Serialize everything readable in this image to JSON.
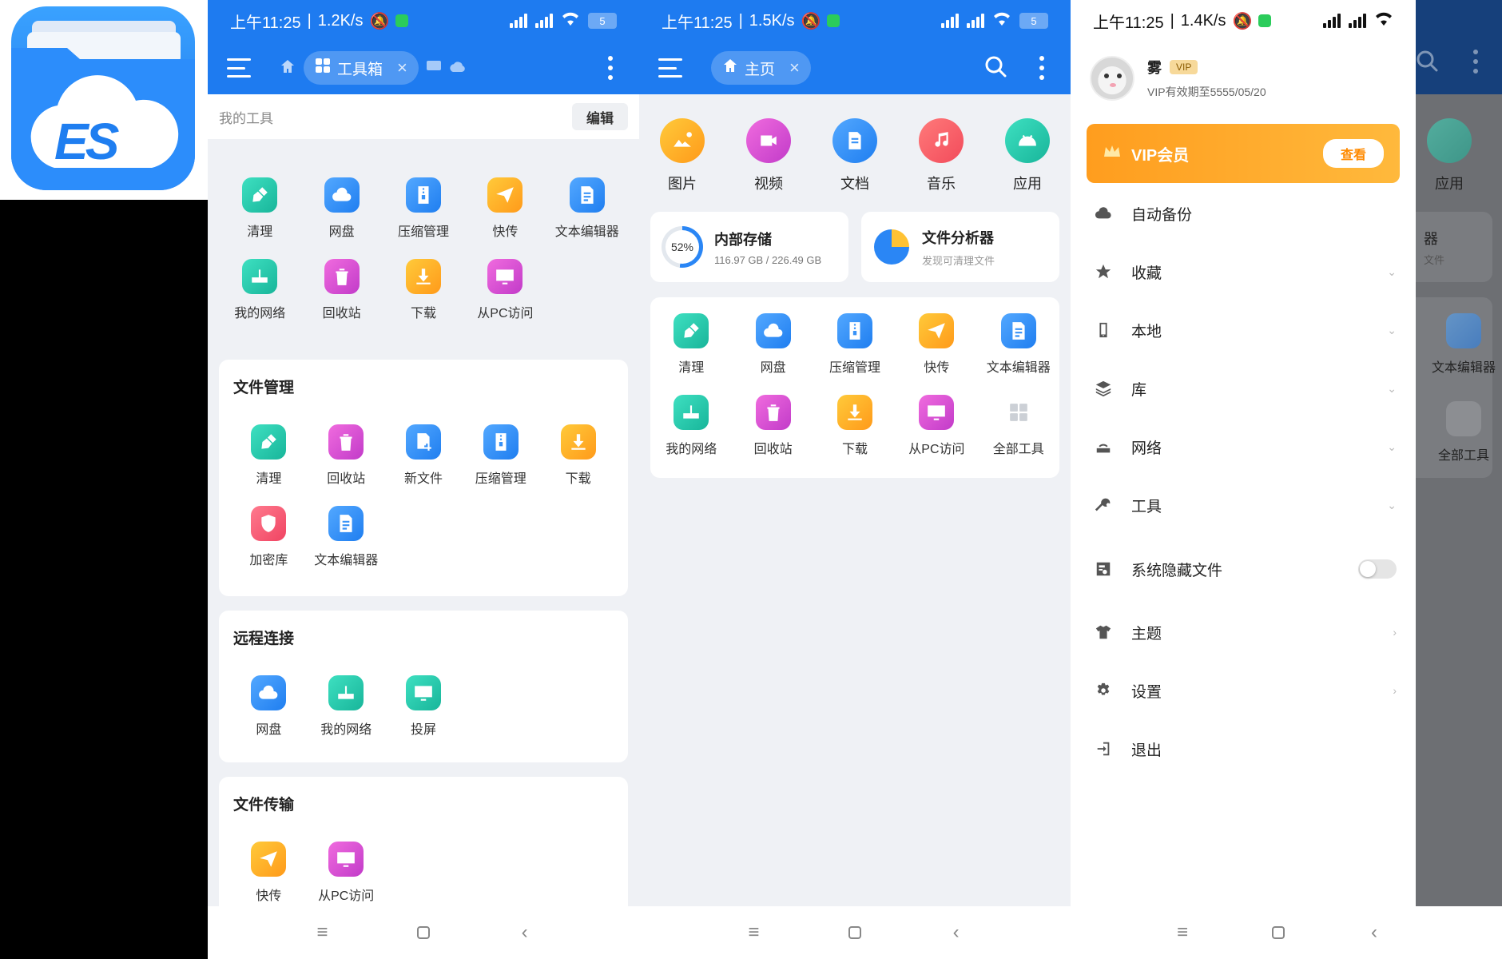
{
  "status": {
    "time": "上午11:25",
    "speed_toolbox": "1.2K/s",
    "speed_home": "1.5K/s",
    "speed_drawer": "1.4K/s",
    "battery": "5"
  },
  "logo": {
    "text": "ES"
  },
  "toolbox": {
    "tab_label": "工具箱",
    "mytools_placeholder": "我的工具",
    "edit_label": "编辑",
    "mytools": [
      {
        "label": "清理"
      },
      {
        "label": "网盘"
      },
      {
        "label": "压缩管理"
      },
      {
        "label": "快传"
      },
      {
        "label": "文本编辑器"
      },
      {
        "label": "我的网络"
      },
      {
        "label": "回收站"
      },
      {
        "label": "下载"
      },
      {
        "label": "从PC访问"
      }
    ],
    "file_mgmt": {
      "title": "文件管理",
      "items": [
        {
          "label": "清理"
        },
        {
          "label": "回收站"
        },
        {
          "label": "新文件"
        },
        {
          "label": "压缩管理"
        },
        {
          "label": "下载"
        },
        {
          "label": "加密库"
        },
        {
          "label": "文本编辑器"
        }
      ]
    },
    "remote": {
      "title": "远程连接",
      "items": [
        {
          "label": "网盘"
        },
        {
          "label": "我的网络"
        },
        {
          "label": "投屏"
        }
      ]
    },
    "transfer": {
      "title": "文件传输",
      "items": [
        {
          "label": "快传"
        },
        {
          "label": "从PC访问"
        }
      ]
    }
  },
  "home": {
    "tab_label": "主页",
    "categories": [
      {
        "label": "图片"
      },
      {
        "label": "视频"
      },
      {
        "label": "文档"
      },
      {
        "label": "音乐"
      },
      {
        "label": "应用"
      }
    ],
    "storage": {
      "title": "内部存储",
      "percent_label": "52%",
      "percent": 52,
      "usage": "116.97 GB / 226.49 GB"
    },
    "analyzer": {
      "title": "文件分析器",
      "subtitle": "发现可清理文件"
    },
    "tools": [
      {
        "label": "清理"
      },
      {
        "label": "网盘"
      },
      {
        "label": "压缩管理"
      },
      {
        "label": "快传"
      },
      {
        "label": "文本编辑器"
      },
      {
        "label": "我的网络"
      },
      {
        "label": "回收站"
      },
      {
        "label": "下载"
      },
      {
        "label": "从PC访问"
      },
      {
        "label": "全部工具"
      }
    ]
  },
  "drawer": {
    "username": "雾",
    "vip_badge": "VIP",
    "vip_expiry": "VIP有效期至5555/05/20",
    "vip_banner": "VIP会员",
    "vip_view": "查看",
    "menu": [
      {
        "label": "自动备份"
      },
      {
        "label": "收藏"
      },
      {
        "label": "本地"
      },
      {
        "label": "库"
      },
      {
        "label": "网络"
      },
      {
        "label": "工具"
      },
      {
        "label": "系统隐藏文件"
      },
      {
        "label": "主题"
      },
      {
        "label": "设置"
      },
      {
        "label": "退出"
      }
    ],
    "peek": {
      "app_label": "应用",
      "analyzer_fragment": "器",
      "analyzer_sub_fragment": "文件",
      "text_editor": "文本编辑器",
      "all_tools": "全部工具"
    }
  }
}
